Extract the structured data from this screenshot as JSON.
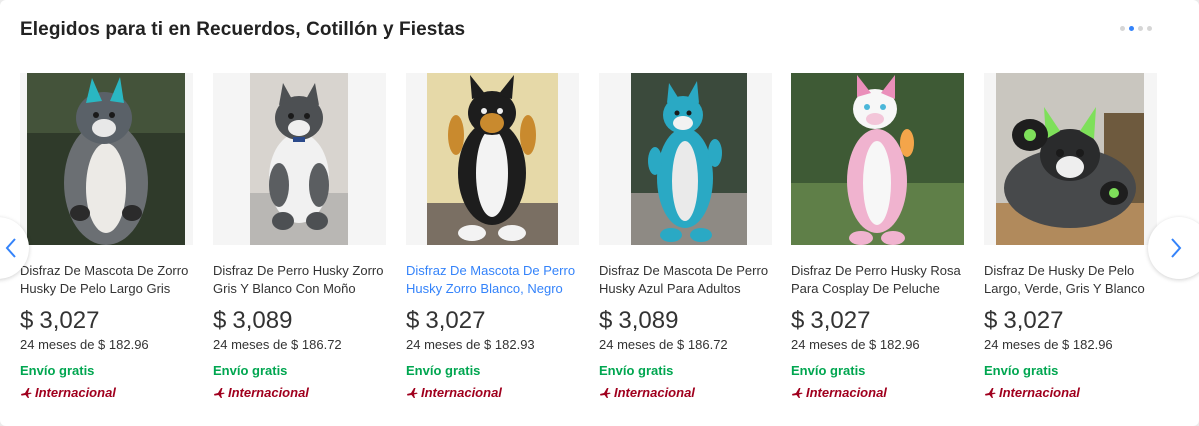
{
  "section": {
    "title": "Elegidos para ti en Recuerdos, Cotillón y Fiestas",
    "pager_dots": 4,
    "active_dot": 2
  },
  "colors": {
    "accent": "#3483fa",
    "shipping_green": "#00a650",
    "international_red": "#a0001e"
  },
  "navigation": {
    "prev_icon": "chevron-left-icon",
    "next_icon": "chevron-right-icon"
  },
  "products": [
    {
      "title": "Disfraz De Mascota De Zorro Husky De Pelo Largo Gris",
      "currency": "$",
      "price": "3,027",
      "installments": "24 meses de $ 182.96",
      "shipping": "Envío gratis",
      "origin": "Internacional",
      "highlighted": false
    },
    {
      "title": "Disfraz De Perro Husky Zorro Gris Y Blanco Con Moño",
      "currency": "$",
      "price": "3,089",
      "installments": "24 meses de $ 186.72",
      "shipping": "Envío gratis",
      "origin": "Internacional",
      "highlighted": false
    },
    {
      "title": "Disfraz De Mascota De Perro Husky Zorro Blanco, Negro",
      "currency": "$",
      "price": "3,027",
      "installments": "24 meses de $ 182.93",
      "shipping": "Envío gratis",
      "origin": "Internacional",
      "highlighted": true
    },
    {
      "title": "Disfraz De Mascota De Perro Husky Azul Para Adultos",
      "currency": "$",
      "price": "3,089",
      "installments": "24 meses de $ 186.72",
      "shipping": "Envío gratis",
      "origin": "Internacional",
      "highlighted": false
    },
    {
      "title": "Disfraz De Perro Husky Rosa Para Cosplay De Peluche",
      "currency": "$",
      "price": "3,027",
      "installments": "24 meses de $ 182.96",
      "shipping": "Envío gratis",
      "origin": "Internacional",
      "highlighted": false
    },
    {
      "title": "Disfraz De Husky De Pelo Largo, Verde, Gris Y Blanco",
      "currency": "$",
      "price": "3,027",
      "installments": "24 meses de $ 182.96",
      "shipping": "Envío gratis",
      "origin": "Internacional",
      "highlighted": false
    }
  ]
}
